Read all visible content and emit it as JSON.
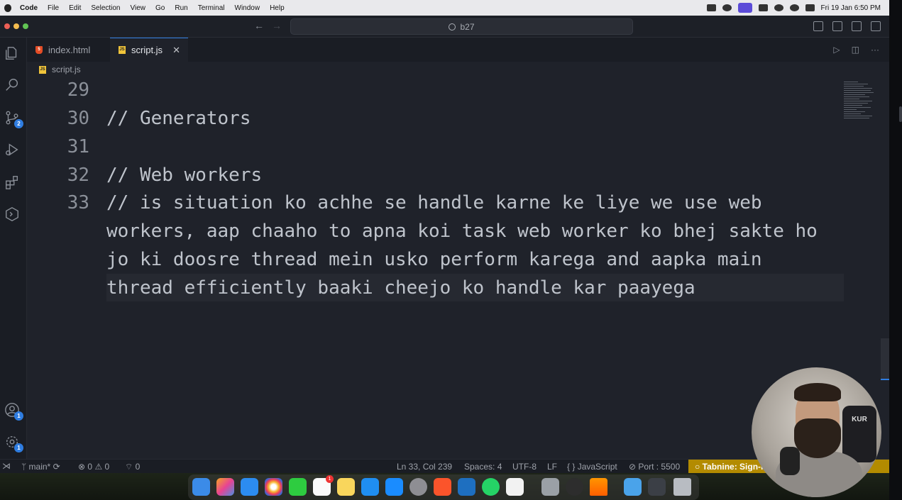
{
  "menubar": {
    "items": [
      "Code",
      "File",
      "Edit",
      "Selection",
      "View",
      "Go",
      "Run",
      "Terminal",
      "Window",
      "Help"
    ],
    "clock": "Fri 19 Jan  6:50 PM"
  },
  "titlebar": {
    "search": "b27"
  },
  "tabs": [
    {
      "label": "index.html",
      "type": "html"
    },
    {
      "label": "script.js",
      "type": "js",
      "active": true
    }
  ],
  "breadcrumb": {
    "file": "script.js"
  },
  "editor": {
    "line_numbers": [
      "29",
      "30",
      "31",
      "32",
      "33"
    ],
    "lines": [
      "",
      "// Generators",
      "",
      "// Web workers",
      "// is situation ko achhe se handle karne ke liye we use web",
      "workers, aap chaaho to apna koi task web worker ko bhej sakte ho",
      "jo ki doosre thread mein usko perform karega and aapka main",
      "thread efficiently baaki cheejo ko handle kar paayega"
    ]
  },
  "activity": {
    "scm_badge": "2",
    "accounts_badge": "1",
    "settings_badge": "1"
  },
  "status": {
    "branch": "main*",
    "errors": "0",
    "warnings": "0",
    "ports": "0",
    "position": "Ln 33, Col 239",
    "spaces": "Spaces: 4",
    "encoding": "UTF-8",
    "eol": "LF",
    "language": "JavaScript",
    "port": "Port : 5500",
    "tabnine": "Tabnine: Sign-i"
  },
  "dock": {
    "reminders_badge": "1"
  },
  "cam": {
    "chair_text": "KUR"
  },
  "colors": {
    "accent": "#2f7de1",
    "tabnine": "#b38b00",
    "editor_bg": "#1f222a"
  }
}
